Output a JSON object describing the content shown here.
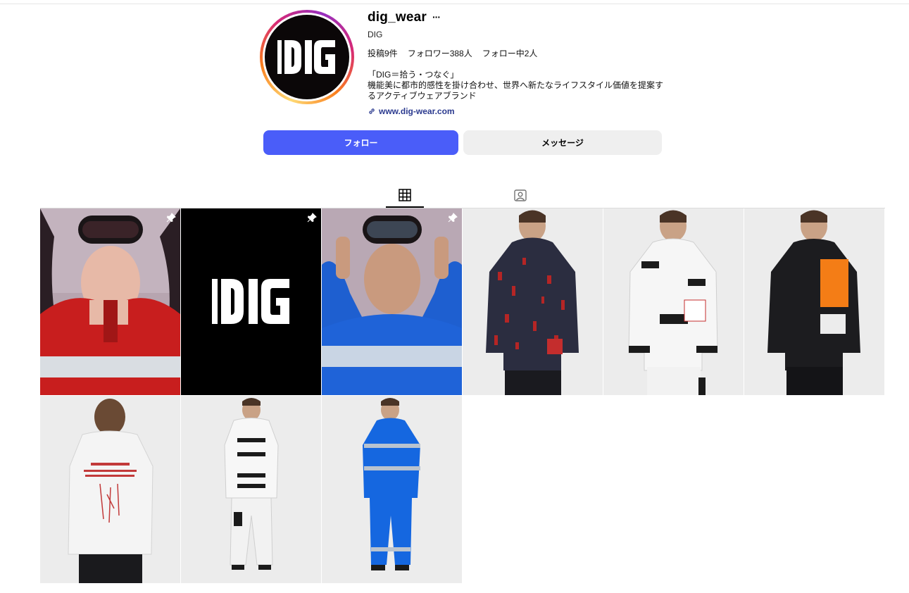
{
  "profile": {
    "username": "dig_wear",
    "full_name": "DIG",
    "avatar_logo": "DIG",
    "stats": {
      "posts": "投稿9件",
      "followers": "フォロワー388人",
      "following": "フォロー中2人"
    },
    "bio": [
      "「DIG＝拾う・つなぐ」",
      "機能美に都市的感性を掛け合わせ、世界へ新たなライフスタイル価値を提案す",
      "るアクティブウェアブランド"
    ],
    "link": "www.dig-wear.com"
  },
  "actions": {
    "follow_label": "フォロー",
    "message_label": "メッセージ"
  },
  "tabs": [
    {
      "name": "posts",
      "icon": "grid-icon",
      "active": true
    },
    {
      "name": "tagged",
      "icon": "tagged-person-icon",
      "active": false
    }
  ],
  "posts": [
    {
      "id": 1,
      "pinned": true,
      "description": "woman in red jacket with ski goggles"
    },
    {
      "id": 2,
      "pinned": true,
      "description": "DIG logo on black",
      "logo": "DIG"
    },
    {
      "id": 3,
      "pinned": true,
      "description": "man in blue jacket with ski goggles"
    },
    {
      "id": 4,
      "pinned": false,
      "description": "model in dark red patterned jacket"
    },
    {
      "id": 5,
      "pinned": false,
      "description": "model in white jacket with black stripes"
    },
    {
      "id": 6,
      "pinned": false,
      "description": "model in black jacket with orange panel"
    },
    {
      "id": 7,
      "pinned": false,
      "description": "back view white shirt with red print"
    },
    {
      "id": 8,
      "pinned": false,
      "description": "model in white striped outfit full body"
    },
    {
      "id": 9,
      "pinned": false,
      "description": "model in blue outfit full body"
    }
  ],
  "colors": {
    "follow_button": "#4a5df9",
    "link": "#2b3a8f",
    "message_button": "#efefef"
  }
}
